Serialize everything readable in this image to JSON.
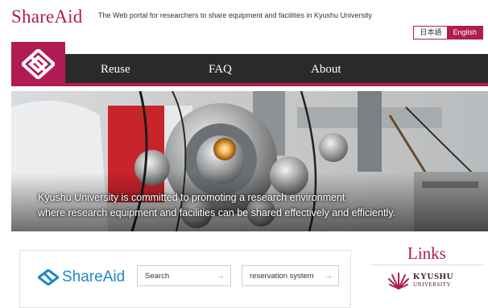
{
  "header": {
    "brand": "ShareAid",
    "tagline": "The Web portal for researchers to share equipment and facilities in Kyushu University",
    "languages": {
      "japanese": "日本語",
      "english": "English",
      "selected": "English"
    }
  },
  "nav": {
    "items": [
      "Reuse",
      "FAQ",
      "About"
    ]
  },
  "hero": {
    "caption_line1": "Kyushu University is committed to promoting a research environment",
    "caption_line2": "where research equipment and facilities can be shared effectively and efficiently."
  },
  "search_card": {
    "logo_text": "ShareAid",
    "search_label": "Search",
    "reservation_label": "reservation system",
    "arrow": "→"
  },
  "links": {
    "title": "Links",
    "kyushu_name": "KYUSHU",
    "kyushu_sub": "UNIVERSITY"
  },
  "colors": {
    "brand": "#b01c52",
    "nav_bg": "#2a2a2a",
    "logo_blue": "#1e88c9"
  }
}
